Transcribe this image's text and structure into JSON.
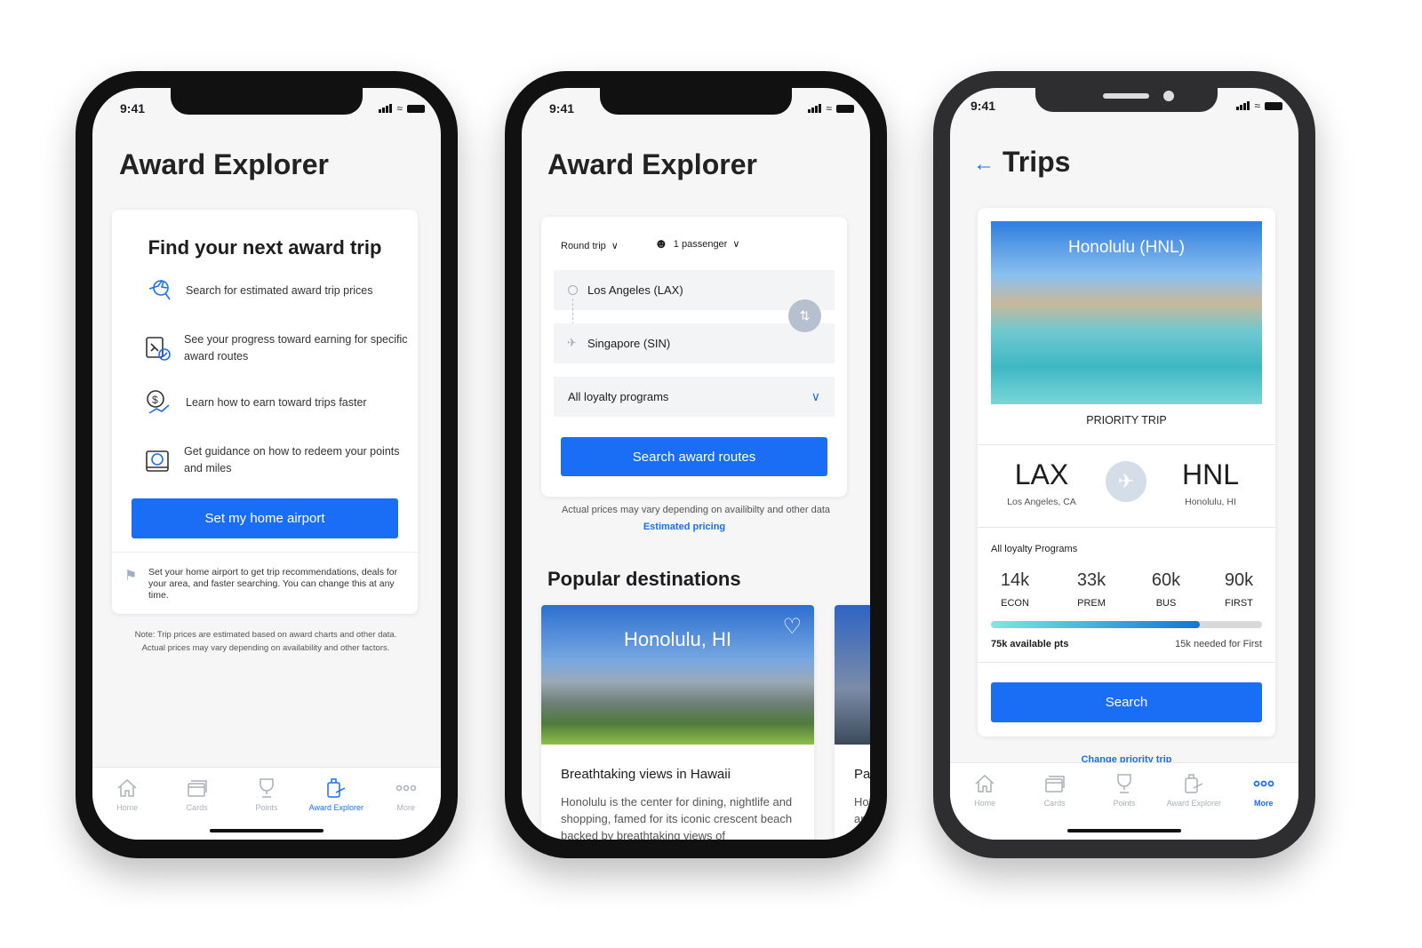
{
  "status_time": "9:41",
  "colors": {
    "accent": "#1a6ef5",
    "progress_start": "#7ee8df",
    "progress_end": "#1574d4"
  },
  "screen1": {
    "title": "Award Explorer",
    "card_title": "Find your next award trip",
    "features": [
      {
        "icon": "plane-search-icon",
        "text": "Search for estimated award trip prices"
      },
      {
        "icon": "route-progress-icon",
        "text": "See your progress toward earning for specific award routes"
      },
      {
        "icon": "earn-money-icon",
        "text": "Learn how to earn toward trips faster"
      },
      {
        "icon": "redeem-guidance-icon",
        "text": "Get guidance on how to redeem your points and miles"
      }
    ],
    "button": "Set my home airport",
    "home_airport_note": "Set your home airport to get trip recommendations, deals for your area, and faster searching. You can change this at any time.",
    "footnote": "Note: Trip prices are estimated based on award charts and other data. Actual prices may vary depending on availability and other factors.",
    "active_tab": "Award Explorer"
  },
  "tabs": [
    {
      "label": "Home",
      "icon": "home-icon"
    },
    {
      "label": "Cards",
      "icon": "cards-icon"
    },
    {
      "label": "Points",
      "icon": "trophy-icon"
    },
    {
      "label": "Award Explorer",
      "icon": "luggage-plane-icon"
    },
    {
      "label": "More",
      "icon": "more-icon"
    }
  ],
  "screen2": {
    "title": "Award Explorer",
    "trip_type": "Round trip",
    "passengers": "1 passenger",
    "origin": "Los Angeles (LAX)",
    "destination": "Singapore (SIN)",
    "loyalty_select": "All loyalty programs",
    "button": "Search award routes",
    "disclaimer": "Actual prices may vary depending on availibilty and other data",
    "link": "Estimated pricing",
    "section_title": "Popular destinations",
    "destinations": [
      {
        "name": "Honolulu, HI",
        "headline": "Breathtaking views in Hawaii",
        "body": "Honolulu is the center for dining, nightlife and shopping, famed for its iconic crescent beach backed by breathtaking views of"
      },
      {
        "headline": "Pa",
        "body": "Ho ar"
      }
    ]
  },
  "screen3": {
    "title": "Trips",
    "image_title": "Honolulu (HNL)",
    "badge": "PRIORITY TRIP",
    "origin_code": "LAX",
    "origin_city": "Los Angeles, CA",
    "dest_code": "HNL",
    "dest_city": "Honolulu, HI",
    "programs_label": "All loyalty Programs",
    "tiers": [
      {
        "pts": "14k",
        "label": "ECON"
      },
      {
        "pts": "33k",
        "label": "PREM"
      },
      {
        "pts": "60k",
        "label": "BUS"
      },
      {
        "pts": "90k",
        "label": "FIRST"
      }
    ],
    "progress_fraction": 0.77,
    "available": "75k available pts",
    "needed": "15k needed for First",
    "button": "Search",
    "change_link": "Change priority trip",
    "active_tab": "More"
  }
}
